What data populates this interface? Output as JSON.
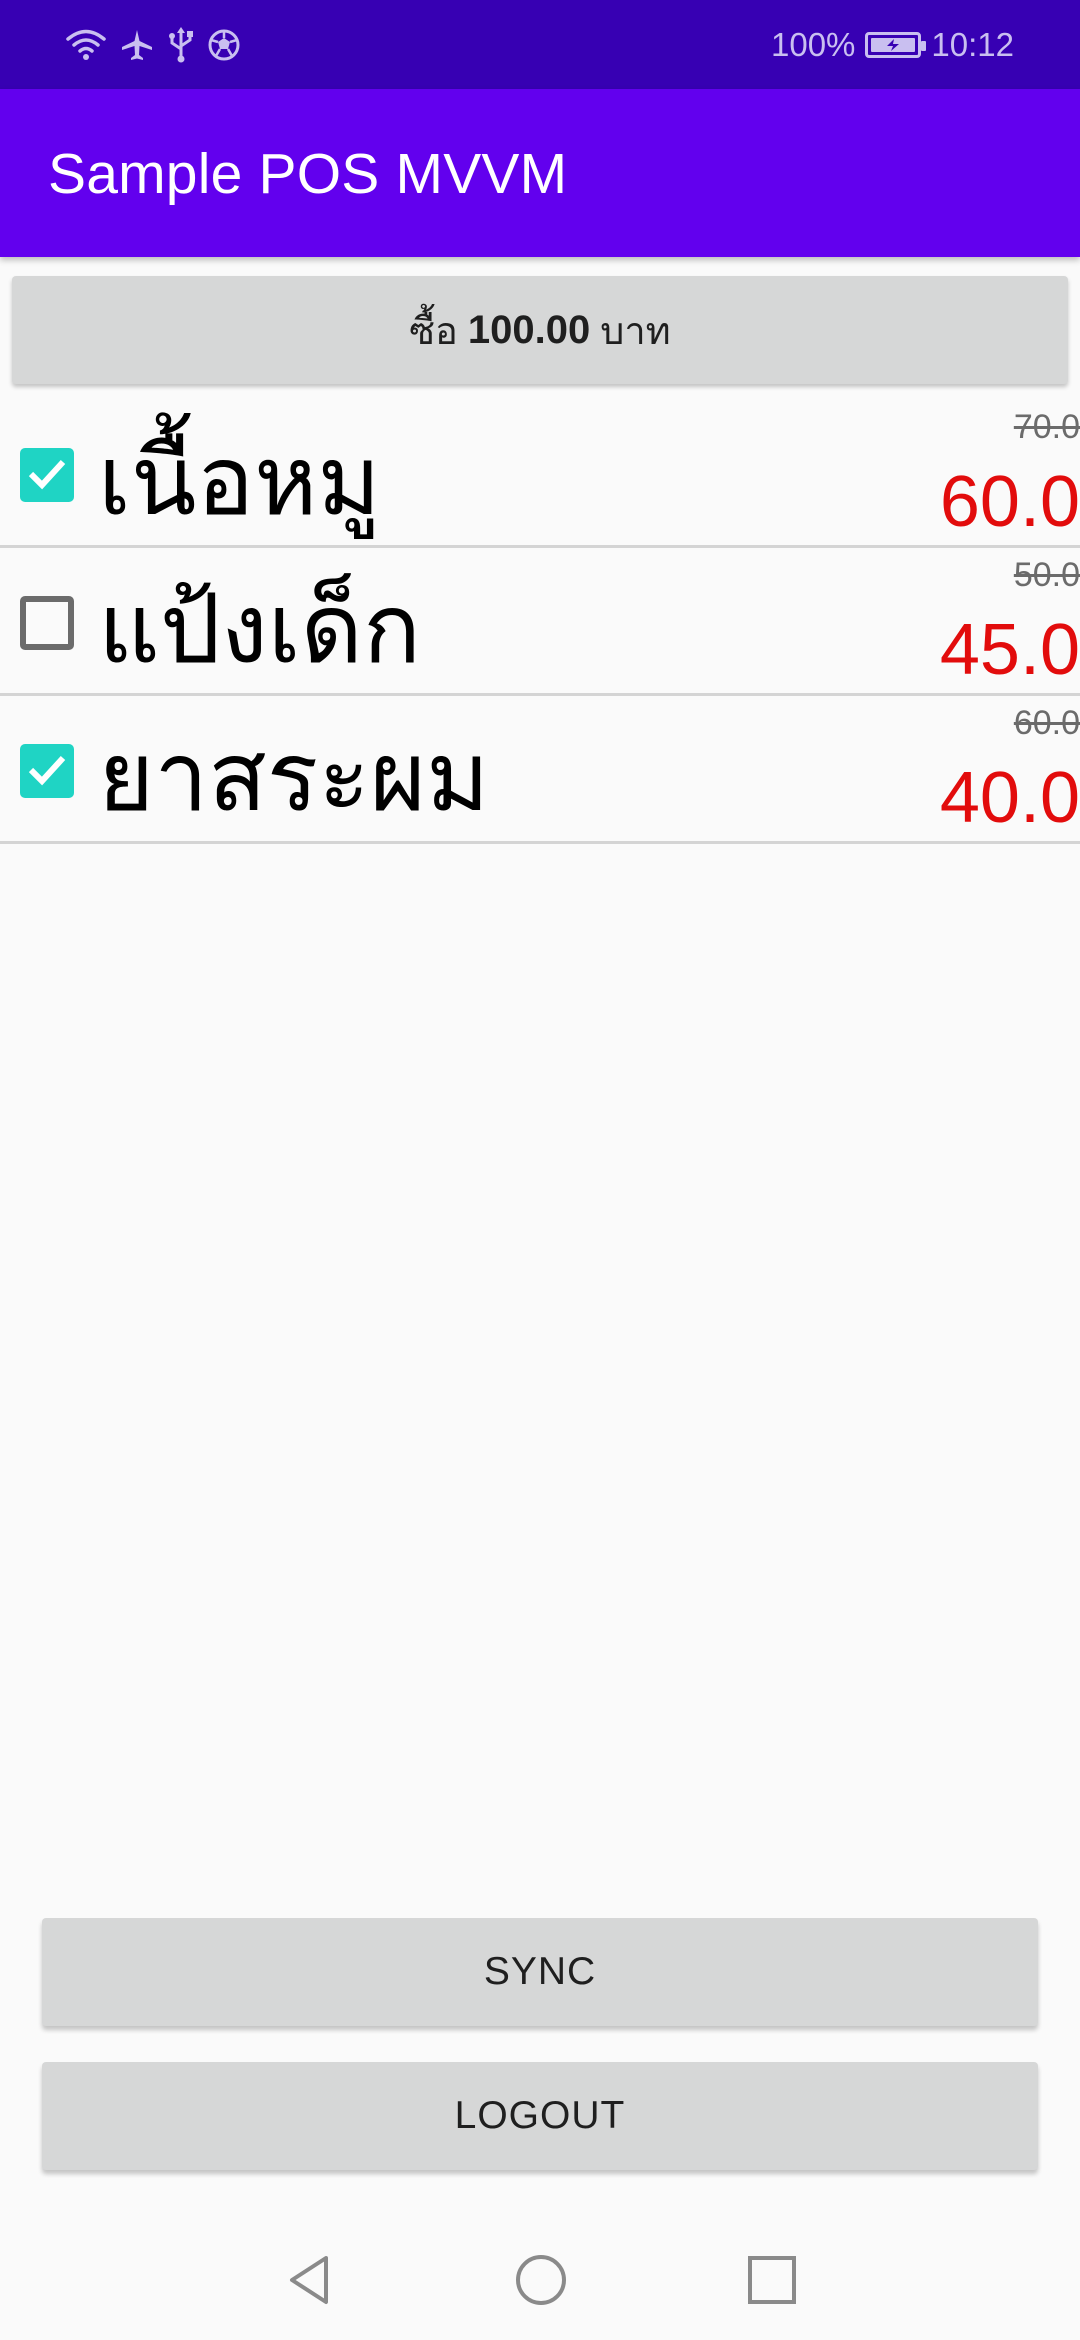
{
  "status_bar": {
    "battery_percent": "100%",
    "time": "10:12",
    "left_icons": [
      "wifi-icon",
      "airplane-icon",
      "usb-icon",
      "soccer-ball-icon"
    ],
    "right_icons": [
      "battery-charging-icon"
    ]
  },
  "app_bar": {
    "title": "Sample POS MVVM"
  },
  "buy_button": {
    "prefix": "ซื้อ",
    "amount": "100.00",
    "suffix": "บาท"
  },
  "products": [
    {
      "name": "เนื้อหมู",
      "old_price": "70.0",
      "new_price": "60.0",
      "checked": true
    },
    {
      "name": "แป้งเด็ก",
      "old_price": "50.0",
      "new_price": "45.0",
      "checked": false
    },
    {
      "name": "ยาสระผม",
      "old_price": "60.0",
      "new_price": "40.0",
      "checked": true
    }
  ],
  "actions": {
    "sync_label": "SYNC",
    "logout_label": "LOGOUT"
  },
  "nav_bar": {
    "icons": [
      "back-icon",
      "home-icon",
      "recents-icon"
    ]
  },
  "colors": {
    "status_bar": "#3700b3",
    "app_bar": "#6200ee",
    "checkbox_checked": "#1fd4c4",
    "price_red": "#e20c0c",
    "button_gray": "#d6d7d7"
  }
}
